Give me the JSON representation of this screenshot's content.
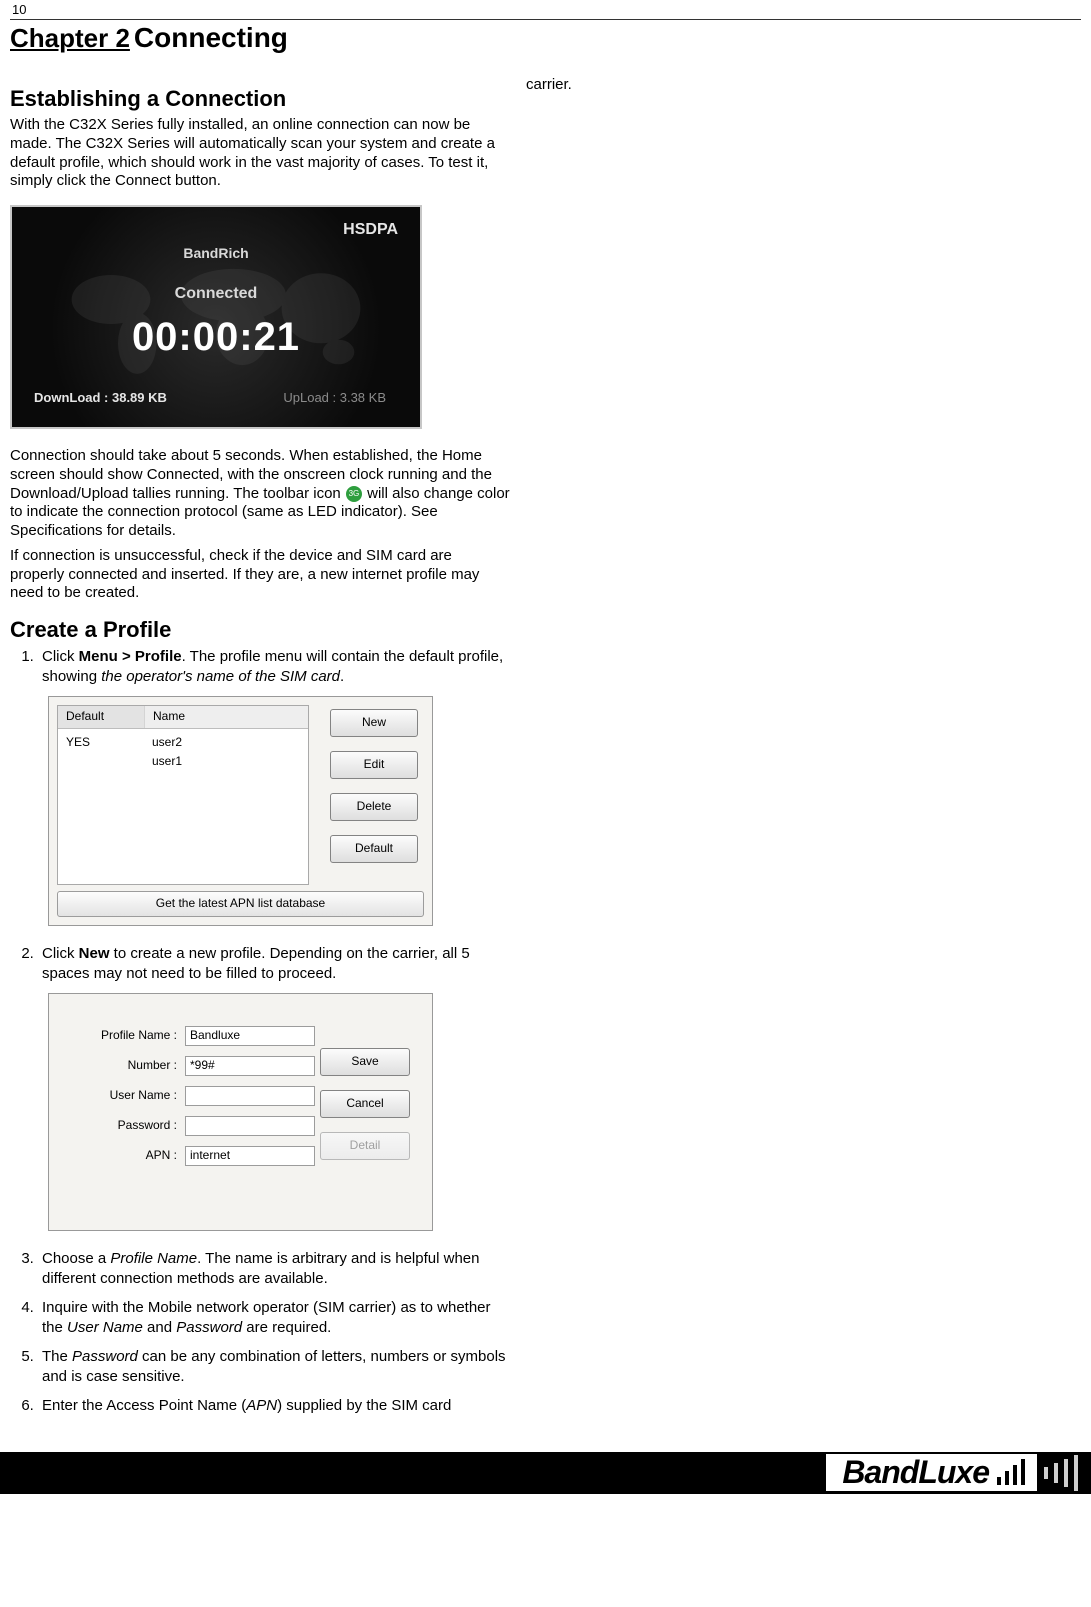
{
  "page_number": "10",
  "chapter_label": "Chapter 2",
  "chapter_title": "Connecting",
  "right_col_fragment": "carrier.",
  "section1": {
    "heading": "Establishing a Connection",
    "intro": "With the C32X Series fully installed, an online connection can now be made. The C32X Series will automatically scan your system and create a default profile, which should work in the vast majority of cases. To test it, simply click the Connect button."
  },
  "conn_shot": {
    "hsdpa": "HSDPA",
    "brand": "BandRich",
    "status": "Connected",
    "clock": "00:00:21",
    "download": "DownLoad : 38.89 KB",
    "upload": "UpLoad : 3.38 KB"
  },
  "paragraphs": {
    "p2_a": "Connection should take about 5 seconds. When established, the Home screen should show Connected, with the onscreen clock running and the Download/Upload tallies running. The toolbar icon ",
    "p2_b": " will also change color to indicate the connection protocol (same as LED indicator). See Specifications for details.",
    "p3": "If connection is unsuccessful, check if the device and SIM card are properly connected and inserted. If they are, a new internet profile may need to be created."
  },
  "icon_label": "3G",
  "section2": {
    "heading": "Create a Profile",
    "step1_a": "Click ",
    "step1_b": "Menu > Profile",
    "step1_c": ". The profile menu will contain the default profile, showing ",
    "step1_d": "the operator's name of the SIM card",
    "step1_e": ".",
    "step2_a": "Click ",
    "step2_b": "New",
    "step2_c": " to create a new profile. Depending on the carrier, all 5 spaces may not need to be filled to proceed.",
    "step3_a": "Choose a ",
    "step3_b": "Profile Name",
    "step3_c": ". The name is arbitrary and is helpful when different connection methods are available.",
    "step4_a": "Inquire with the Mobile network operator (SIM carrier) as to whether the ",
    "step4_b": "User Name",
    "step4_c": " and ",
    "step4_d": "Password",
    "step4_e": " are required.",
    "step5_a": "The ",
    "step5_b": "Password",
    "step5_c": " can be any combination of letters, numbers or symbols and is case sensitive.",
    "step6_a": "Enter the Access Point Name (",
    "step6_b": "APN",
    "step6_c": ") supplied by the SIM card"
  },
  "dlg1": {
    "col_default": "Default",
    "col_name": "Name",
    "row1_def": "YES",
    "row1_name": "user2",
    "row2_name": "user1",
    "btn_new": "New",
    "btn_edit": "Edit",
    "btn_delete": "Delete",
    "btn_default": "Default",
    "btn_bottom": "Get the latest APN list database"
  },
  "dlg2": {
    "lbl_profile": "Profile Name :",
    "val_profile": "Bandluxe",
    "lbl_number": "Number :",
    "val_number": "*99#",
    "lbl_user": "User Name :",
    "val_user": "",
    "lbl_pass": "Password :",
    "val_pass": "",
    "lbl_apn": "APN :",
    "val_apn": "internet",
    "btn_save": "Save",
    "btn_cancel": "Cancel",
    "btn_detail": "Detail"
  },
  "footer_logo": "BandLuxe"
}
